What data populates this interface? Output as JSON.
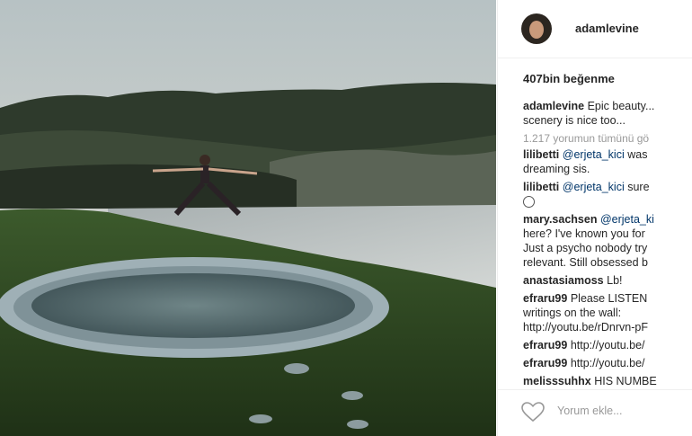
{
  "post": {
    "username": "adamlevine",
    "likes": "407bin beğenme",
    "caption": {
      "user": "adamlevine",
      "line1": "Epic beauty...",
      "line2": "scenery is nice too..."
    },
    "view_all_comments": "1.217 yorumun tümünü gö",
    "comments": [
      {
        "user": "lilibetti",
        "mention": "@erjeta_kici",
        "text": "was",
        "line2": "dreaming sis."
      },
      {
        "user": "lilibetti",
        "mention": "@erjeta_kici",
        "text": "sure",
        "emoji": "smiley-face"
      },
      {
        "user": "mary.sachsen",
        "mention": "@erjeta_ki",
        "text": "",
        "line2": "here? I've known you for",
        "line3": "Just a psycho nobody try",
        "line4": "relevant. Still obsessed b"
      },
      {
        "user": "anastasiamoss",
        "text": "Lb!"
      },
      {
        "user": "efraru99",
        "text": "Please LISTEN",
        "line2": "writings on the wall:",
        "line3": "http://youtu.be/rDnrvn-pF"
      },
      {
        "user": "efraru99",
        "text": "http://youtu.be/"
      },
      {
        "user": "efraru99",
        "text": "http://youtu.be/"
      },
      {
        "user": "melisssuhhx",
        "text": "HIS NUMBE"
      }
    ],
    "add_comment_placeholder": "Yorum ekle...",
    "icons": {
      "like": "heart-icon",
      "avatar": "profile-avatar"
    }
  }
}
